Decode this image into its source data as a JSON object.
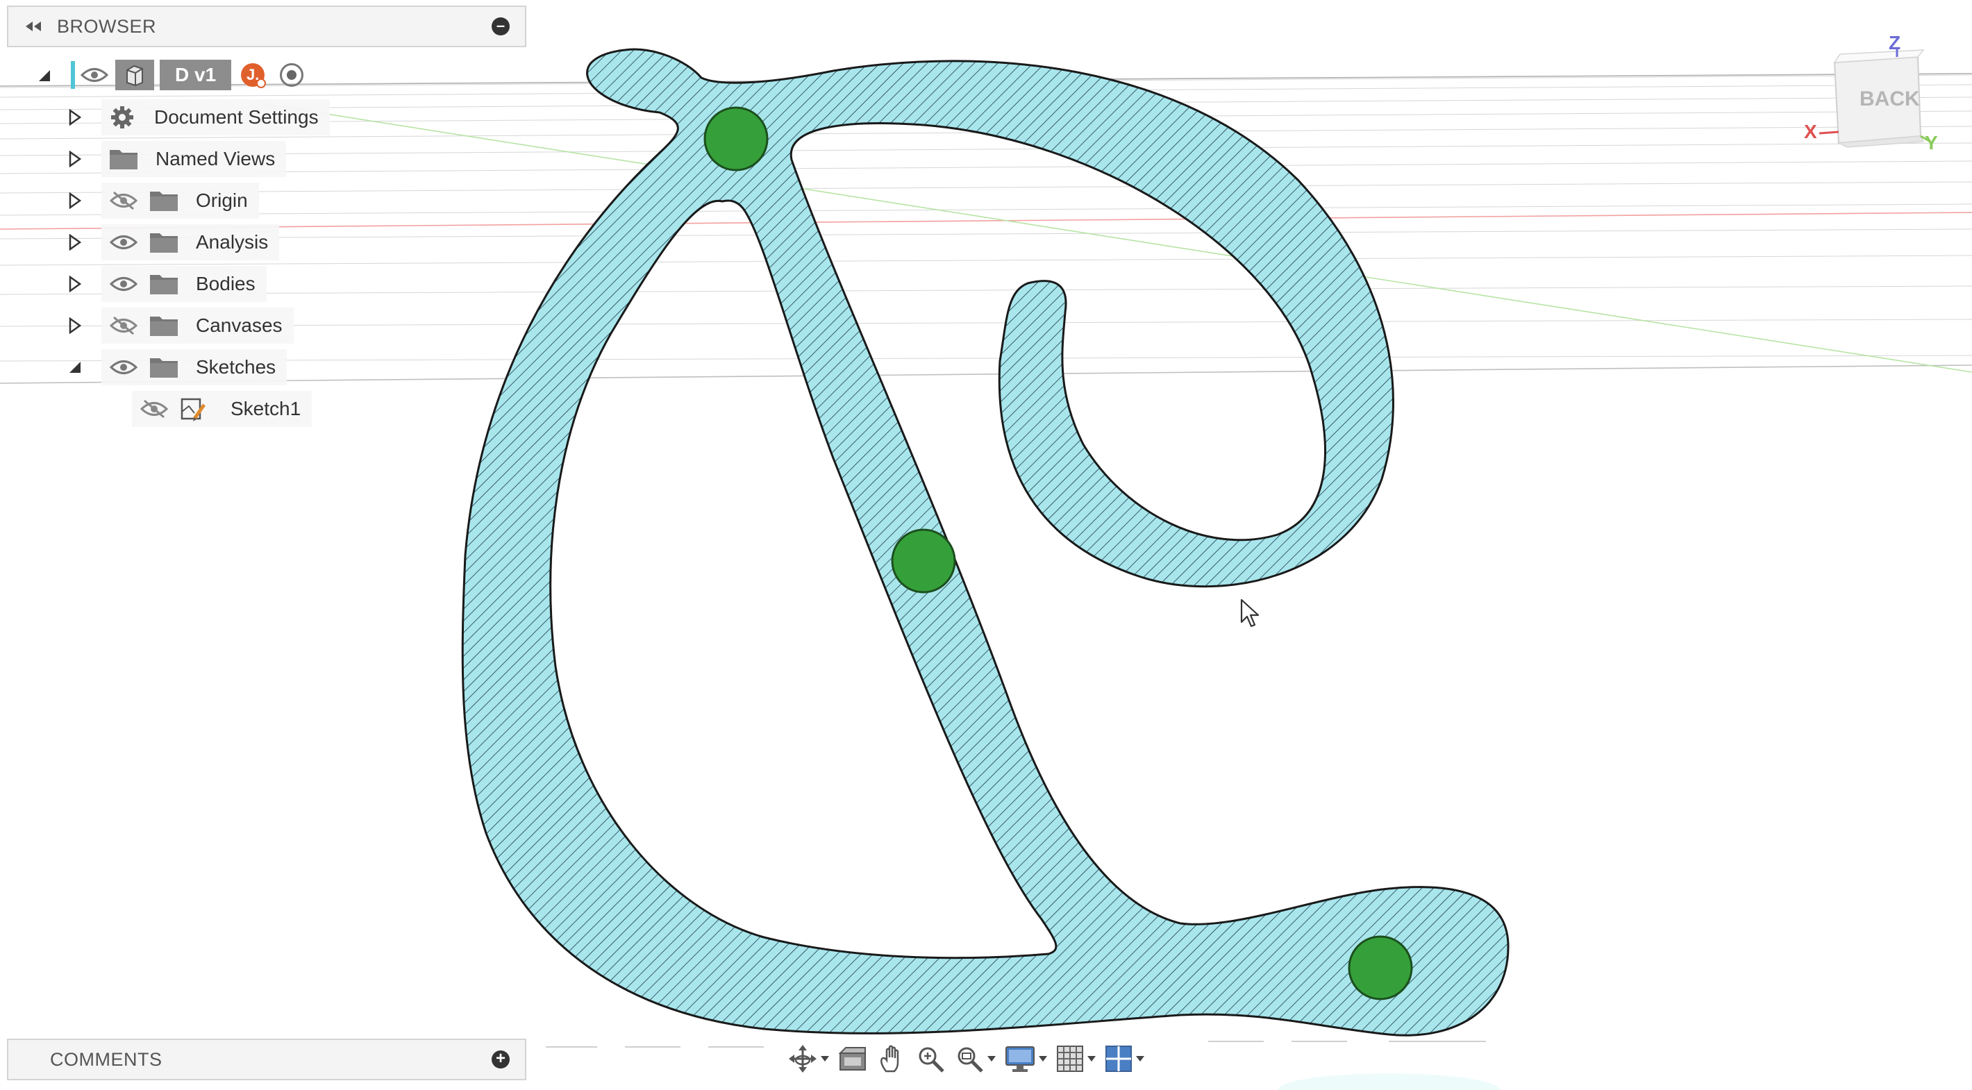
{
  "browser": {
    "title": "BROWSER",
    "root": {
      "name": "D v1",
      "user_initial": "J."
    },
    "items": [
      {
        "label": "Document Settings"
      },
      {
        "label": "Named Views"
      },
      {
        "label": "Origin"
      },
      {
        "label": "Analysis"
      },
      {
        "label": "Bodies"
      },
      {
        "label": "Canvases"
      },
      {
        "label": "Sketches"
      },
      {
        "label": "Sketch1"
      }
    ]
  },
  "comments": {
    "title": "COMMENTS"
  },
  "viewcube": {
    "face": "BACK",
    "axis_z": "Z",
    "axis_x": "X",
    "axis_y": "Y"
  },
  "colors": {
    "profile_fill": "#a8e6ec",
    "hatch": "#1e3a4a",
    "point": "#35a03a",
    "axis_z": "#6b6bd8",
    "axis_x": "#e05050",
    "axis_y": "#8acb5c"
  },
  "icons": {
    "tree": [
      "eye-icon",
      "eye-hidden-icon",
      "folder-icon",
      "gear-icon",
      "sketch-icon",
      "component-icon"
    ],
    "toolbar": [
      "orbit-icon",
      "look-at-icon",
      "pan-icon",
      "zoom-icon",
      "zoom-window-icon",
      "display-settings-icon",
      "grid-icon",
      "viewports-icon"
    ]
  }
}
